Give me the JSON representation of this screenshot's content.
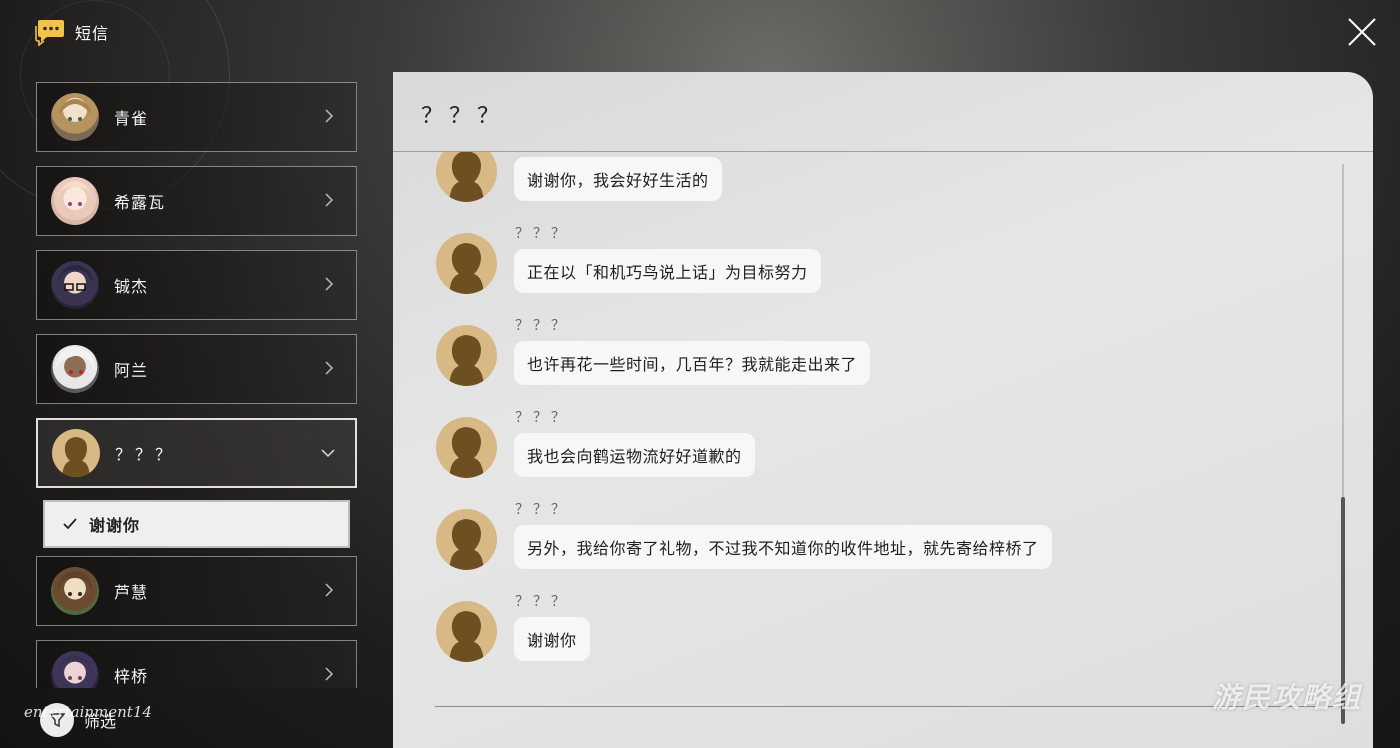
{
  "header": {
    "title": "短信"
  },
  "contacts": [
    {
      "name": "青雀"
    },
    {
      "name": "希露瓦"
    },
    {
      "name": "铖杰"
    },
    {
      "name": "阿兰"
    },
    {
      "name": "？？？"
    },
    {
      "name": "芦慧"
    },
    {
      "name": "梓桥"
    }
  ],
  "sub_item": {
    "label": "谢谢你",
    "selected": true
  },
  "filter": {
    "label": "筛选"
  },
  "chat": {
    "title": "？？？",
    "messages": [
      {
        "sender": "？？？",
        "text": "谢谢你，我会好好生活的"
      },
      {
        "sender": "？？？",
        "text": "正在以「和机巧鸟说上话」为目标努力"
      },
      {
        "sender": "？？？",
        "text": "也许再花一些时间，几百年？我就能走出来了"
      },
      {
        "sender": "？？？",
        "text": "我也会向鹤运物流好好道歉的"
      },
      {
        "sender": "？？？",
        "text": "另外，我给你寄了礼物，不过我不知道你的收件地址，就先寄给梓桥了"
      },
      {
        "sender": "？？？",
        "text": "谢谢你"
      }
    ]
  },
  "watermarks": {
    "left": "entertainment14",
    "right": "游民攻略组"
  },
  "colors": {
    "unknown_avatar": "#d8b884",
    "bubble": "#f7f7f7",
    "panel": "#e0e0e0"
  },
  "icons": {
    "app": "message-bubble-icon",
    "close": "close-icon",
    "chevron": "chevron-right-icon",
    "expanded": "chevron-down-icon",
    "check": "check-icon",
    "filter": "filter-icon"
  }
}
